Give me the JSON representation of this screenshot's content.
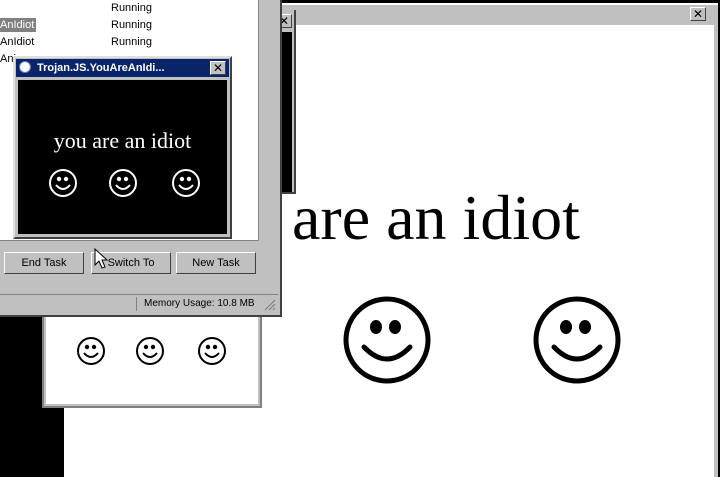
{
  "big_window": {
    "message": "are an idiot",
    "close_glyph": "✕"
  },
  "back_window": {
    "close_glyph": "✕"
  },
  "task_manager": {
    "tasks": [
      {
        "name": "",
        "status": "Running"
      },
      {
        "name": "AnIdiot",
        "status": "Running"
      },
      {
        "name": "AnIdiot",
        "status": "Running"
      },
      {
        "name": "Ani",
        "status": ""
      }
    ],
    "buttons": {
      "end_task": "End Task",
      "switch_to": "Switch To",
      "new_task": "New Task"
    },
    "memory_usage": "Memory Usage: 10.8 MB"
  },
  "popup": {
    "title": "Trojan.JS.YouAreAnIdi...",
    "message": "you are an idiot",
    "close_glyph": "✕"
  },
  "icons": [
    "smiley-face-icon",
    "close-icon",
    "window-icon",
    "resize-grip-icon"
  ],
  "colors": {
    "titlebar_active": "#0a246a",
    "titlebar_inactive": "#c0c0c0",
    "popup_bg": "#000000",
    "window_face": "#c0c0c0"
  }
}
